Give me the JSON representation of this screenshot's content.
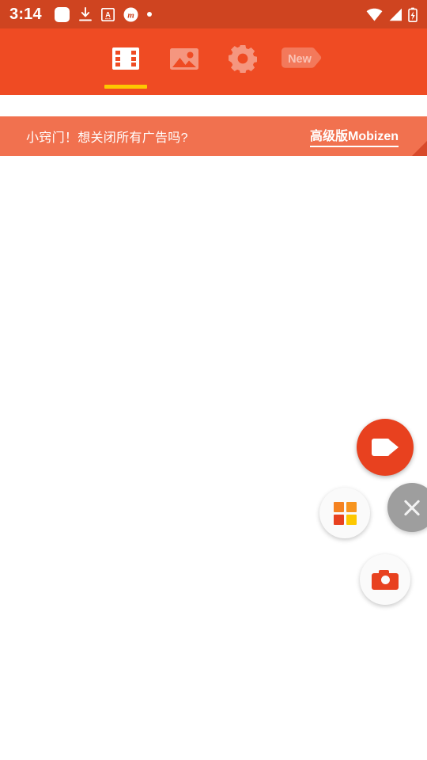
{
  "statusbar": {
    "time": "3:14",
    "left_icons": [
      {
        "name": "rounded-square-icon",
        "glyph": "square"
      },
      {
        "name": "download-icon",
        "glyph": "download"
      },
      {
        "name": "translate-icon",
        "glyph": "translate-a"
      },
      {
        "name": "mobizen-notification-icon",
        "glyph": "m-circle"
      },
      {
        "name": "more-notifications-dot-icon",
        "glyph": "dot"
      }
    ],
    "right_icons": [
      {
        "name": "wifi-icon",
        "glyph": "wifi"
      },
      {
        "name": "cellular-signal-icon",
        "glyph": "signal"
      },
      {
        "name": "battery-charging-icon",
        "glyph": "battery-charging"
      }
    ],
    "background_color": "#cf4420",
    "foreground_color": "#ffffff"
  },
  "tabbar": {
    "background_color": "#ef4b23",
    "indicator_color": "#fdc800",
    "tabs": [
      {
        "name": "tab-videos",
        "icon": "film-strip-icon",
        "label": "",
        "active": true
      },
      {
        "name": "tab-images",
        "icon": "image-icon",
        "label": "",
        "active": false
      },
      {
        "name": "tab-settings",
        "icon": "gear-icon",
        "label": "",
        "active": false
      },
      {
        "name": "tab-new",
        "icon": "new-tag-icon",
        "label": "New",
        "active": false
      }
    ]
  },
  "banner": {
    "message": "小窍门！想关闭所有广告吗?",
    "link_label": "高级版Mobizen",
    "background_color": "#f1714f",
    "fold_color": "#d8492a"
  },
  "content": {
    "background_color": "#ffffff",
    "items": []
  },
  "floating_widget": {
    "record_button": {
      "name": "record-button",
      "icon": "video-camera-icon",
      "color": "#e8411f"
    },
    "apps_button": {
      "name": "apps-button",
      "icon": "four-squares-icon",
      "color": "#fafafa",
      "square_colors": [
        "#f58220",
        "#f7941e",
        "#e8411f",
        "#fdc800"
      ]
    },
    "close_button": {
      "name": "close-button",
      "icon": "close-icon",
      "color": "#9e9e9e"
    },
    "capture_button": {
      "name": "screenshot-button",
      "icon": "camera-icon",
      "color": "#fafafa",
      "glyph_color": "#e8411f"
    }
  }
}
